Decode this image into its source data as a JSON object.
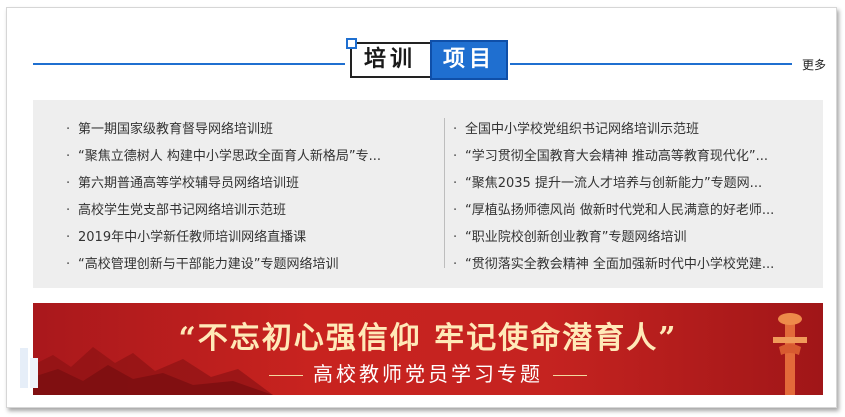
{
  "header": {
    "title_part1": "培训",
    "title_part2": "项目",
    "more_label": "更多"
  },
  "list": {
    "left": [
      {
        "bullet": "·",
        "text": "第一期国家级教育督导网络培训班"
      },
      {
        "bullet": "·",
        "text": "“聚焦立德树人 构建中小学思政全面育人新格局”专..."
      },
      {
        "bullet": "·",
        "text": "第六期普通高等学校辅导员网络培训班"
      },
      {
        "bullet": "·",
        "text": "高校学生党支部书记网络培训示范班"
      },
      {
        "bullet": "·",
        "text": "2019年中小学新任教师培训网络直播课"
      },
      {
        "bullet": "·",
        "text": "“高校管理创新与干部能力建设”专题网络培训"
      }
    ],
    "right": [
      {
        "bullet": "·",
        "text": "全国中小学校党组织书记网络培训示范班"
      },
      {
        "bullet": "·",
        "text": "“学习贯彻全国教育大会精神 推动高等教育现代化”..."
      },
      {
        "bullet": "·",
        "text": "“聚焦2035 提升一流人才培养与创新能力”专题网..."
      },
      {
        "bullet": "·",
        "text": "“厚植弘扬师德风尚 做新时代党和人民满意的好老师..."
      },
      {
        "bullet": "·",
        "text": "“职业院校创新创业教育”专题网络培训"
      },
      {
        "bullet": "·",
        "text": "“贯彻落实全教会精神 全面加强新时代中小学校党建..."
      }
    ]
  },
  "banner": {
    "slogan": "“不忘初心强信仰 牢记使命潜育人”",
    "subtitle": "高校教师党员学习专题"
  },
  "colors": {
    "accent": "#1f6fd0",
    "banner_red": "#c52320",
    "banner_gold": "#ffe9b8",
    "panel_bg": "#eeeeee"
  },
  "icons": {
    "title_corner": "corner-square-icon",
    "banner_left": "mountain-graphic",
    "banner_right": "huabiao-pillar-graphic"
  }
}
